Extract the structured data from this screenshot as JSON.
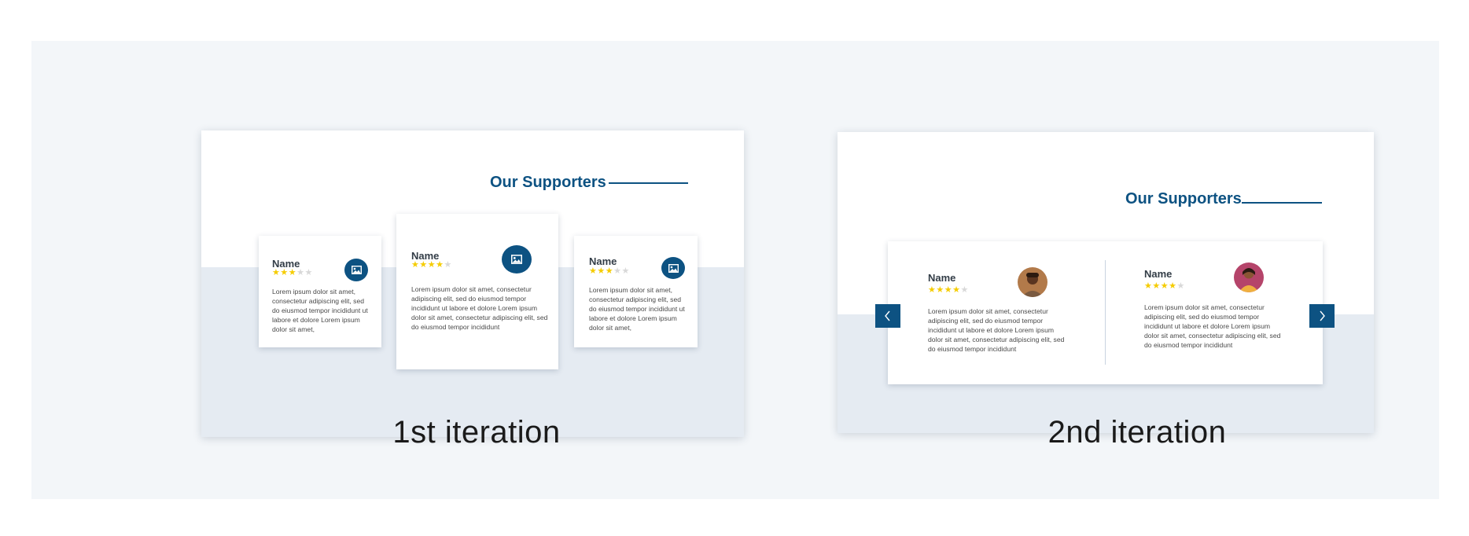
{
  "iteration_1": {
    "title": "Our Supporters",
    "caption": "1st iteration",
    "cards": [
      {
        "name": "Name",
        "stars_on": "★★★",
        "stars_off": "★★",
        "text": "Lorem ipsum dolor sit amet, consectetur adipiscing elit, sed do eiusmod tempor incididunt ut labore et dolore Lorem ipsum dolor sit amet,",
        "icon": "image-icon"
      },
      {
        "name": "Name",
        "stars_on": "★★★★",
        "stars_off": "★",
        "text": "Lorem ipsum dolor sit amet, consectetur adipiscing elit, sed do eiusmod tempor incididunt ut labore et dolore Lorem ipsum dolor sit amet, consectetur adipiscing elit, sed do eiusmod tempor incididunt",
        "icon": "image-icon"
      },
      {
        "name": "Name",
        "stars_on": "★★★",
        "stars_off": "★★",
        "text": "Lorem ipsum dolor sit amet, consectetur adipiscing elit, sed do eiusmod tempor incididunt ut labore et dolore Lorem ipsum dolor sit amet,",
        "icon": "image-icon"
      }
    ]
  },
  "iteration_2": {
    "title": "Our Supporters",
    "caption": "2nd iteration",
    "prev_icon": "chevron-left-icon",
    "next_icon": "chevron-right-icon",
    "testimonials": [
      {
        "name": "Name",
        "stars_on": "★★★★",
        "stars_off": "★",
        "text": "Lorem ipsum dolor sit amet, consectetur adipiscing elit, sed do eiusmod tempor incididunt ut labore et dolore Lorem ipsum dolor sit amet, consectetur adipiscing elit, sed do eiusmod tempor incididunt",
        "avatar": "person-avatar"
      },
      {
        "name": "Name",
        "stars_on": "★★★★",
        "stars_off": "★",
        "text": "Lorem ipsum dolor sit amet, consectetur adipiscing elit, sed do eiusmod tempor incididunt ut labore et dolore Lorem ipsum dolor sit amet, consectetur adipiscing elit, sed do eiusmod tempor incididunt",
        "avatar": "person-avatar"
      }
    ]
  },
  "colors": {
    "accent": "#0d5282",
    "band": "#e5ebf2",
    "board": "#f3f6f9",
    "star_on": "#f5cc00",
    "star_off": "#d8d8d8"
  }
}
